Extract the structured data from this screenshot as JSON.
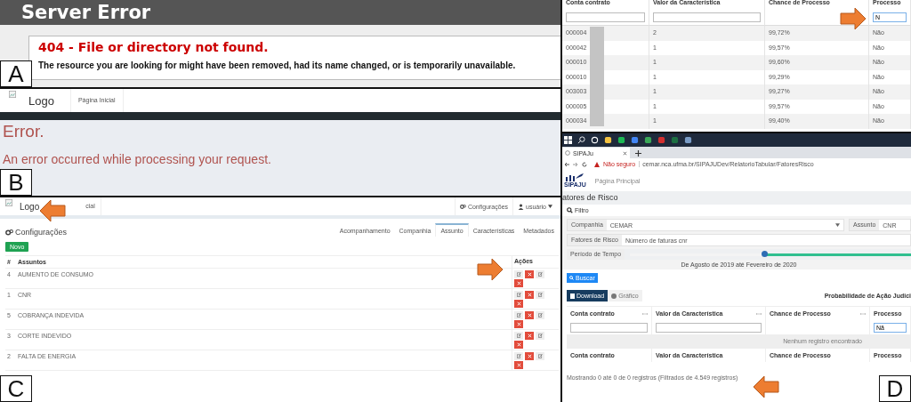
{
  "panel_a": {
    "label": "A",
    "title": "Server Error",
    "heading": "404 - File or directory not found.",
    "message": "The resource you are looking for might have been removed, had its name changed, or is temporarily unavailable."
  },
  "panel_b": {
    "label": "B",
    "logo": "Logo",
    "nav": "Página Inicial",
    "heading": "Error.",
    "message": "An error occurred while processing your request."
  },
  "panel_c": {
    "label": "C",
    "logo": "Logo",
    "nav": "cial",
    "top_links": [
      {
        "kind": "settings",
        "label": "Configurações"
      },
      {
        "kind": "user",
        "label": "usuário"
      }
    ],
    "page_title": "Configurações",
    "tabs": [
      {
        "label": "Acompanhamento",
        "selected": false
      },
      {
        "label": "Companhia",
        "selected": false
      },
      {
        "label": "Assunto",
        "selected": true
      },
      {
        "label": "Características",
        "selected": false
      },
      {
        "label": "Metadados",
        "selected": false
      }
    ],
    "new_button": "Novo",
    "columns": [
      "#",
      "Assuntos",
      "Ações"
    ],
    "rows": [
      {
        "id": "4",
        "name": "AUMENTO DE CONSUMO"
      },
      {
        "id": "1",
        "name": "CNR"
      },
      {
        "id": "5",
        "name": "COBRANÇA INDEVIDA"
      },
      {
        "id": "3",
        "name": "CORTE INDEVIDO"
      },
      {
        "id": "2",
        "name": "FALTA DE ENERGIA"
      }
    ]
  },
  "panel_d": {
    "label": "D",
    "results": {
      "columns": [
        "Conta contrato",
        "Valor da Característica",
        "Chance de Processo",
        "Processo"
      ],
      "processo_filter": "N",
      "rows": [
        {
          "conta": "000004",
          "valor": "2",
          "chance": "99,72%",
          "processo": "Não"
        },
        {
          "conta": "000042",
          "valor": "1",
          "chance": "99,57%",
          "processo": "Não"
        },
        {
          "conta": "000010",
          "valor": "1",
          "chance": "99,60%",
          "processo": "Não"
        },
        {
          "conta": "000010",
          "valor": "1",
          "chance": "99,29%",
          "processo": "Não"
        },
        {
          "conta": "003003",
          "valor": "1",
          "chance": "99,27%",
          "processo": "Não"
        },
        {
          "conta": "000005",
          "valor": "1",
          "chance": "99,57%",
          "processo": "Não"
        },
        {
          "conta": "000034",
          "valor": "1",
          "chance": "99,40%",
          "processo": "Não"
        }
      ]
    },
    "browser": {
      "tab": "SIPAJu",
      "security": "Não seguro",
      "url": "cemar.nca.ufma.br/SIPAJUDev/RelatorioTabular/FatoresRisco"
    },
    "app": {
      "logo": "SIPAJU",
      "nav": "Página Principal",
      "page_title": "atores de Risco",
      "filter_title": "Filtro",
      "fields": [
        {
          "label": "Companhia",
          "value": "CEMAR",
          "kind": "select"
        },
        {
          "label": "Assunto",
          "value": "CNR",
          "kind": "text"
        },
        {
          "label": "Fatores de Risco",
          "value": "Número de faturas cnr",
          "kind": "text"
        }
      ],
      "period": {
        "label": "Período de Tempo",
        "level": 0.48,
        "caption": "De Agosto de 2019 até Fevereiro de 2020"
      },
      "search_button": "Buscar",
      "views": [
        {
          "label": "Download",
          "selected": true
        },
        {
          "label": "Gráfico",
          "selected": false
        }
      ],
      "table_title": "Probabilidade de Ação Judici",
      "columns": [
        "Conta contrato",
        "Valor da Característica",
        "Chance de Processo",
        "Processo"
      ],
      "processo_filter": "Nã",
      "empty_message": "Nenhum registro encontrado",
      "footer_columns": [
        "Conta contrato",
        "Valor da Característica",
        "Chance de Processo",
        "Processo"
      ],
      "info": "Mostrando 0 até 0 de 0 registros (Filtrados de 4.549 registros)"
    }
  }
}
